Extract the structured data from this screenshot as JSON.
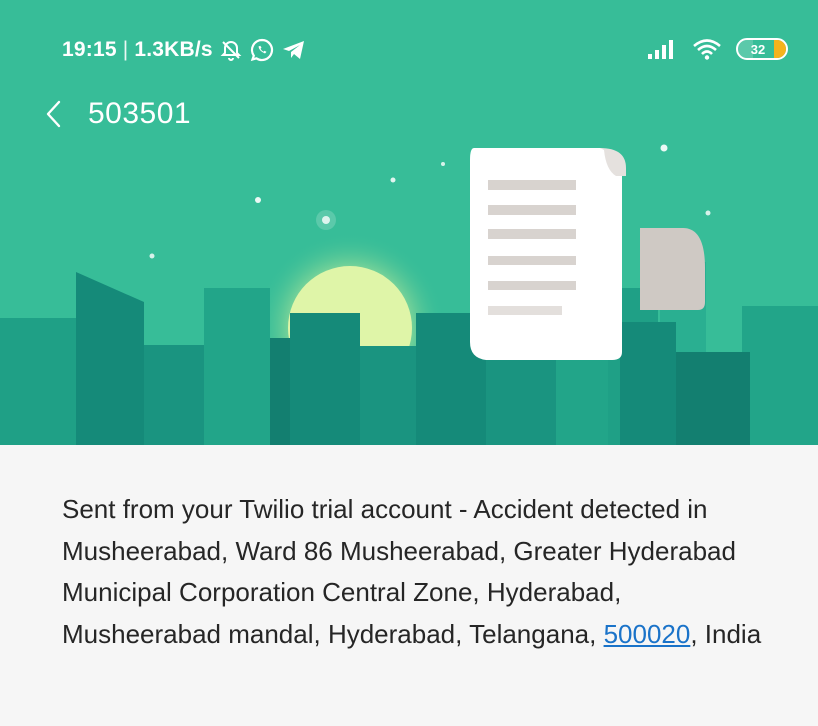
{
  "status_bar": {
    "time": "19:15",
    "separator": "|",
    "network_speed": "1.3KB/s",
    "icons": [
      "alarm-off-icon",
      "whatsapp-icon",
      "telegram-icon",
      "signal-icon",
      "wifi-icon",
      "battery-icon"
    ],
    "battery_level": "32",
    "battery_fraction": 0.32
  },
  "header": {
    "title": "503501",
    "back_icon": "chevron-left-icon",
    "colors": {
      "background": "#37bd98",
      "buildings_dark": "#158a79",
      "buildings_mid": "#1fa086",
      "buildings_light": "#2aaf91",
      "sun": "#dff5a8"
    },
    "illustration": "document-scroll-icon"
  },
  "message": {
    "text_before_link": "Sent from your Twilio trial account - Accident detected in Musheerabad, Ward 86 Musheerabad, Greater Hyderabad Municipal Corporation Central Zone, Hyderabad, Musheerabad mandal, Hyderabad, Telangana, ",
    "link_text": "500020",
    "text_after_link": ", India",
    "link_color": "#1a73c9",
    "text_color": "#262626"
  }
}
